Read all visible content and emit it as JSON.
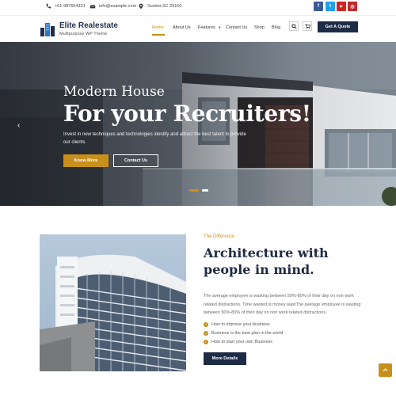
{
  "topbar": {
    "phone": "+01-987654321",
    "email": "info@example.com",
    "address": "Sumter,SC 29150",
    "phone_icon": "phone-icon",
    "email_icon": "envelope-icon",
    "address_icon": "map-pin-icon",
    "social": [
      {
        "icon": "facebook-icon",
        "glyph": "f",
        "color": "#3b5998"
      },
      {
        "icon": "twitter-icon",
        "glyph": "t",
        "color": "#1da1f2"
      },
      {
        "icon": "youtube-icon",
        "glyph": "▶",
        "color": "#d32323"
      },
      {
        "icon": "instagram-icon",
        "glyph": "◎",
        "color": "#c1272d"
      }
    ]
  },
  "header": {
    "logo_title": "Elite Realestate",
    "logo_subtitle": "Multipurpose WP Theme",
    "nav": [
      "Home",
      "About Us",
      "Features",
      "Contact Us",
      "Shop",
      "Blog"
    ],
    "active_nav": "Home",
    "search_icon": "search-icon",
    "cart_icon": "cart-icon",
    "quote_label": "Get A Quote"
  },
  "hero": {
    "kicker": "Modern House",
    "title": "For your Recruiters!",
    "description": "Invest in new techniques and technologies identify and attract the best talent to provide our clients.",
    "primary_button": "Know More",
    "secondary_button": "Contact Us",
    "prev_icon": "chevron-left-icon",
    "next_icon": "chevron-right-icon",
    "slides_total": 2,
    "active_slide": 1
  },
  "about": {
    "kicker": "The Difference",
    "title": "Architecture with people in mind.",
    "description": "The average employee is wasting between 50%-80% of their day on non work related distractions. Time wasted is money wastThe average employee is wasting between 50%-80% of their day on non work related distractions.",
    "checklist": [
      "How to improve your business",
      "Business is the best plan in the world",
      "How to start your own Business"
    ],
    "button": "More Details"
  },
  "scroll_top_icon": "arrow-up-icon",
  "colors": {
    "accent": "#c8901b",
    "navy": "#1e2b47"
  }
}
